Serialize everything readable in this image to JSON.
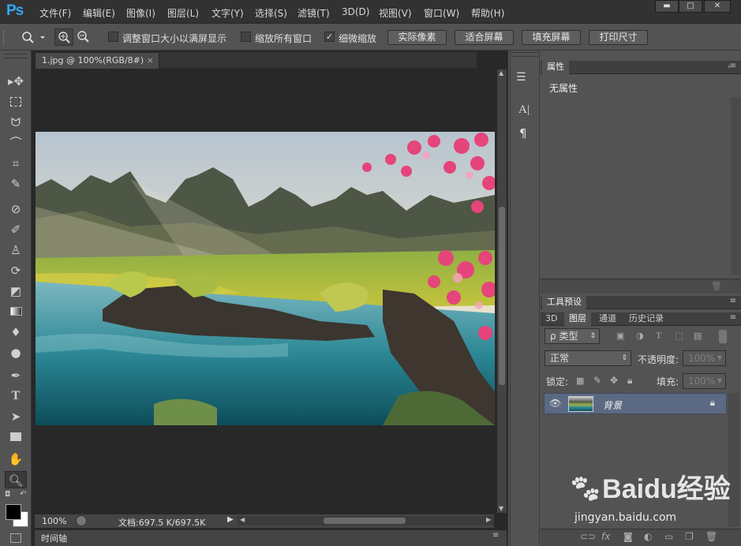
{
  "app": {
    "logo": "Ps"
  },
  "menu": [
    "文件(F)",
    "编辑(E)",
    "图像(I)",
    "图层(L)",
    "文字(Y)",
    "选择(S)",
    "滤镜(T)",
    "3D(D)",
    "视图(V)",
    "窗口(W)",
    "帮助(H)"
  ],
  "window_controls": {
    "minimize": "▬",
    "maximize": "□",
    "close": "✕"
  },
  "options": {
    "resize_windows_label": "调整窗口大小以满屏显示",
    "resize_windows_checked": false,
    "zoom_all_label": "缩放所有窗口",
    "zoom_all_checked": false,
    "scrubby_zoom_label": "细微缩放",
    "scrubby_zoom_checked": true,
    "btn_actual_pixels": "实际像素",
    "btn_fit_screen": "适合屏幕",
    "btn_fill_screen": "填充屏幕",
    "btn_print_size": "打印尺寸"
  },
  "document": {
    "tab_title": "1.jpg @ 100%(RGB/8#)",
    "tab_close": "×"
  },
  "status": {
    "zoom": "100%",
    "doc_size": "文档:697.5 K/697.5K"
  },
  "timeline": {
    "label": "时间轴"
  },
  "properties": {
    "tab": "属性",
    "empty_text": "无属性"
  },
  "tool_presets": {
    "tab": "工具预设"
  },
  "layers": {
    "tabs": [
      "3D",
      "图层",
      "通道",
      "历史记录"
    ],
    "active_tab": "图层",
    "filter_label": "类型",
    "blend_mode": "正常",
    "opacity_label": "不透明度:",
    "opacity_value": "100%",
    "lock_label": "锁定:",
    "fill_label": "填充:",
    "fill_value": "100%",
    "layer_name": "背景"
  },
  "watermark": {
    "logo": "Baidu经验",
    "url": "jingyan.baidu.com"
  },
  "colors": {
    "accent": "#31a8ff",
    "selected_layer": "#5b6a82"
  }
}
